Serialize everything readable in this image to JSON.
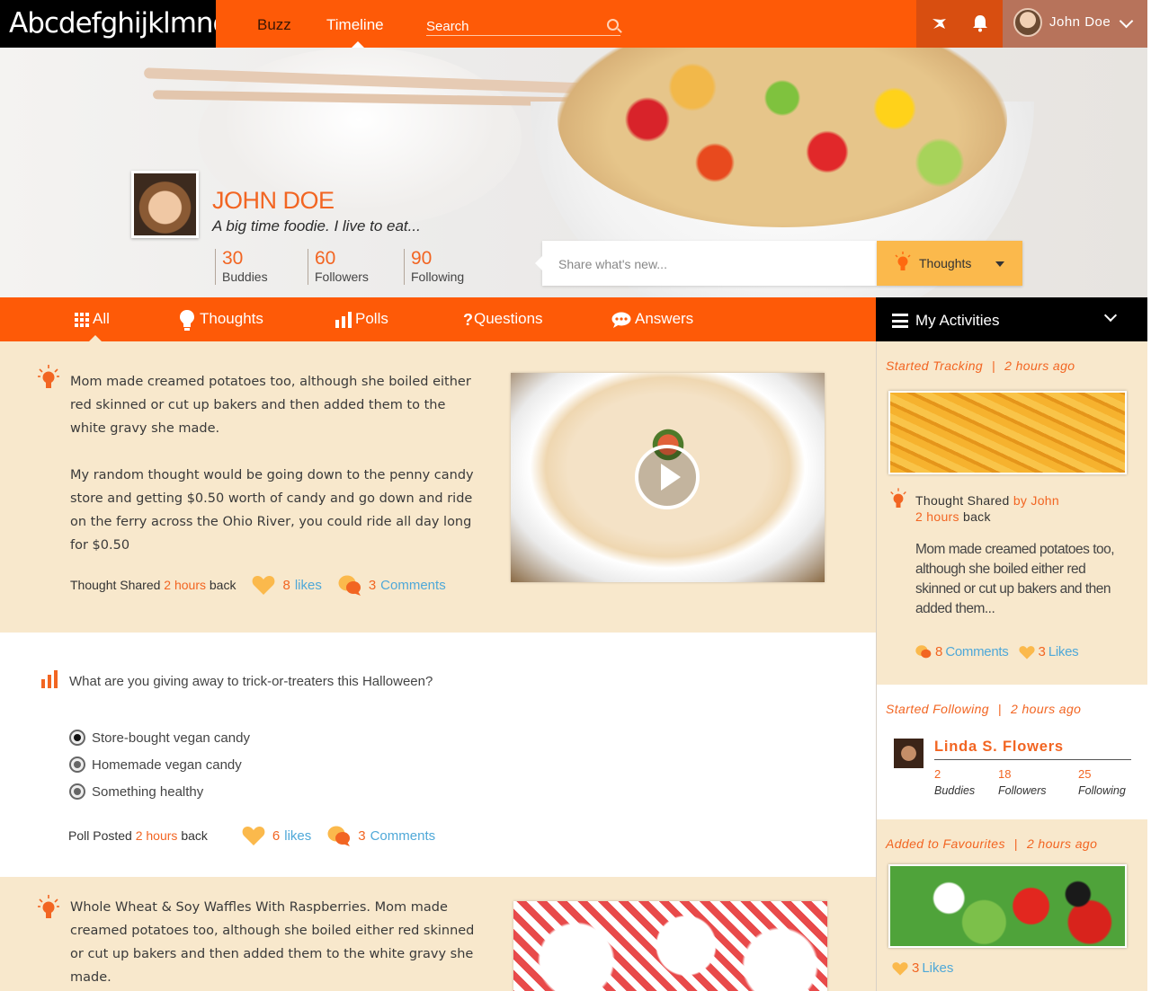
{
  "app": {
    "logo_text": "Abcdefghijklmno"
  },
  "topnav": {
    "links": [
      {
        "label": "Buzz"
      },
      {
        "label": "Timeline"
      }
    ],
    "search_placeholder": "Search",
    "user_name": "John Doe"
  },
  "profile": {
    "name": "JOHN DOE",
    "tagline": "A big time foodie. I live to eat...",
    "stats": [
      {
        "value": "30",
        "label": "Buddies"
      },
      {
        "value": "60",
        "label": "Followers"
      },
      {
        "value": "90",
        "label": "Following"
      }
    ]
  },
  "share": {
    "placeholder": "Share what's new...",
    "type_label": "Thoughts"
  },
  "filters": [
    {
      "label": "All",
      "icon": "grid-icon"
    },
    {
      "label": "Thoughts",
      "icon": "bulb-icon"
    },
    {
      "label": "Polls",
      "icon": "bar-chart-icon"
    },
    {
      "label": "Questions",
      "icon": "question-icon"
    },
    {
      "label": "Answers",
      "icon": "chat-bubbles-icon"
    }
  ],
  "feed": {
    "post1": {
      "paragraphs": [
        "Mom made creamed potatoes too, although she boiled either red skinned or cut up bakers and then added them to the white gravy she made.",
        "My random thought would be going down to the penny candy store and getting $0.50 worth of candy and go down and ride on the ferry across the Ohio River, you could ride all day long for $0.50"
      ],
      "meta_prefix": "Thought Shared",
      "meta_time": "2 hours",
      "meta_suffix": "back",
      "likes_num": "8",
      "likes_label": "likes",
      "comments_num": "3",
      "comments_label": "Comments"
    },
    "post2": {
      "question": "What are you giving away to trick-or-treaters this Halloween?",
      "options": [
        "Store-bought vegan candy",
        "Homemade vegan candy",
        "Something healthy"
      ],
      "meta_prefix": "Poll Posted",
      "meta_time": "2 hours",
      "meta_suffix": "back",
      "likes_num": "6",
      "likes_label": "likes",
      "comments_num": "3",
      "comments_label": "Comments"
    },
    "post3": {
      "text": "Whole Wheat & Soy Waffles With Raspberries. Mom made creamed potatoes too, although she boiled either red skinned or cut up bakers and then added them to the white gravy she made."
    }
  },
  "activities": {
    "title": "My Activities",
    "card1": {
      "action": "Started Tracking",
      "time": "2 hours ago",
      "shared_prefix": "Thought Shared",
      "shared_by": "by",
      "shared_name": "John",
      "shared_time": "2 hours",
      "shared_suffix": "back",
      "excerpt": "Mom made creamed potatoes too, although she boiled either red skinned or cut up bakers and then added them...",
      "comments_num": "8",
      "comments_label": "Comments",
      "likes_num": "3",
      "likes_label": "Likes"
    },
    "card2": {
      "action": "Started Following",
      "time": "2 hours ago",
      "name": "Linda S. Flowers",
      "stats": [
        {
          "value": "2",
          "label": "Buddies"
        },
        {
          "value": "18",
          "label": "Followers"
        },
        {
          "value": "25",
          "label": "Following"
        }
      ]
    },
    "card3": {
      "action": "Added to Favourites",
      "time": "2 hours ago",
      "likes_num": "3",
      "likes_label": "Likes"
    }
  },
  "colors": {
    "primary": "#fe5a07",
    "accent_text": "#f26522",
    "link": "#4fa8d8",
    "panel": "#f8e8cc",
    "like": "#fbb94c"
  }
}
